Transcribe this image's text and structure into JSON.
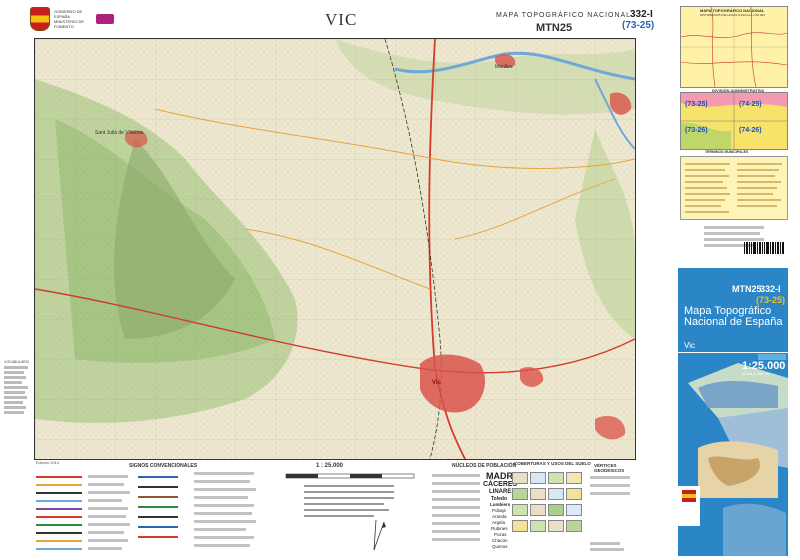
{
  "header": {
    "agency_lines": [
      "GOBIERNO DE ESPAÑA",
      "MINISTERIO DE FOMENTO"
    ],
    "sheet_name": "VIC",
    "title": "MAPA TOPOGRÁFICO NACIONAL",
    "series": "MTN25",
    "sheet_number": "332-I",
    "grid_ref": "(73-25)"
  },
  "map": {
    "towns": {
      "main": "Vic",
      "north": "Manlleu",
      "west": "Sant Julià de Vilatorta"
    }
  },
  "side": {
    "vocab_title": "VOCABULARIO",
    "credit": "Edición 2014"
  },
  "legend": {
    "signs_title": "SIGNOS CONVENCIONALES",
    "scale": "1 : 25.000",
    "population_title": "NÚCLEOS DE POBLACIÓN",
    "population_words": [
      "MADRID",
      "CÁCERES",
      "LINARES",
      "Toledo",
      "Lumbiers",
      "Pobaje",
      "Aranda",
      "Argela",
      "Rubines",
      "Pozas",
      "Chacón",
      "Quimos"
    ],
    "cover_title": "COBERTURAS Y USOS DEL SUELO",
    "geodesic_title": "VÉRTICES GEODÉSICOS"
  },
  "right_panel": {
    "index_title": "MAPA TOPOGRÁFICO NACIONAL",
    "index_subtitle": "DISTRIBUCIÓN DE HOJAS A ESCALA 1:50.000",
    "admin_title": "DIVISIÓN ADMINISTRATIVA",
    "admin_codes": [
      "(73-25)",
      "(74-25)",
      "(73-26)",
      "(74-26)"
    ],
    "muni_title": "TÉRMINOS MUNICIPALES",
    "cover": {
      "series": "MTN25",
      "sheet_number": "332-I",
      "grid_ref": "(73-25)",
      "title": "Mapa Topográfico Nacional de España",
      "sheet_name": "Vic",
      "scale": "1:25.000",
      "scale_equivalence": "(1 cm = 250 m)"
    }
  },
  "colors": {
    "accent_blue": "#2b86c8",
    "urban_red": "#c8322a",
    "terrain_green": "#9cbf7a",
    "river_blue": "#6fa8d8"
  }
}
